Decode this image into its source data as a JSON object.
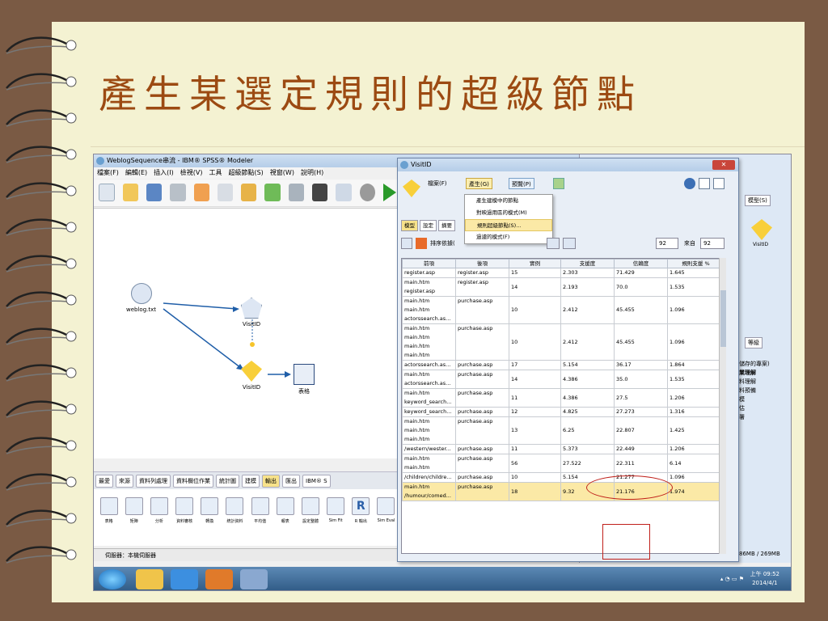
{
  "slide": {
    "title": "產生某選定規則的超級節點"
  },
  "main_window": {
    "title": "WeblogSequence串流 - IBM® SPSS® Modeler",
    "menu": [
      "檔案(F)",
      "編輯(E)",
      "插入(I)",
      "檢視(V)",
      "工具",
      "超級節點(S)",
      "視窗(W)",
      "說明(H)"
    ],
    "nodes": {
      "source": "weblog.txt",
      "seq1": "VisitID",
      "seq2": "VisitID",
      "table": "表格"
    },
    "palette_tabs": [
      "最愛",
      "來源",
      "資料列處理",
      "資料欄位作業",
      "統計圖",
      "建模",
      "輸出",
      "匯出",
      "IBM® S"
    ],
    "palette_items": [
      "表格",
      "矩陣",
      "分析",
      "資料審核",
      "轉換",
      "統計資料",
      "平均值",
      "報表",
      "設定整體",
      "Sim Fit",
      "R 輸出",
      "Sim Eval"
    ],
    "status": "伺服器：本機伺服器",
    "right_panel_button": "模型(S)",
    "right_node": "VisitID",
    "right_tab": "等級",
    "right_list": [
      "儲存的專案)",
      "業理解",
      "料理解",
      "料預備",
      "模",
      "估",
      "署"
    ],
    "memory": "86MB / 269MB"
  },
  "dialog": {
    "title": "VisitID",
    "menu": {
      "file": "檔案(F)",
      "generate": "產生(G)",
      "preview": "預覽(P)"
    },
    "generate_menu": [
      "產生建模中的節點",
      "對映過用區的模式(M)",
      "規則超級節點(S)...",
      "過濾的模式(F)"
    ],
    "tabs": [
      "模型",
      "設定",
      "摘要"
    ],
    "sort_label": "排序依據(",
    "shown_count": "92",
    "of_label": "來自",
    "total_count": "92",
    "columns": [
      "前項",
      "後項",
      "實例",
      "支援度",
      "信賴度",
      "規則支援 %"
    ],
    "rows": [
      {
        "antecedent": [
          "register.asp"
        ],
        "consequent": "register.asp",
        "instances": "15",
        "support": "2.303",
        "confidence": "71.429",
        "rule_support": "1.645"
      },
      {
        "antecedent": [
          "main.htm",
          "register.asp"
        ],
        "consequent": "register.asp",
        "instances": "14",
        "support": "2.193",
        "confidence": "70.0",
        "rule_support": "1.535"
      },
      {
        "antecedent": [
          "main.htm",
          "main.htm",
          "actorssearch.as..."
        ],
        "consequent": "purchase.asp",
        "instances": "10",
        "support": "2.412",
        "confidence": "45.455",
        "rule_support": "1.096"
      },
      {
        "antecedent": [
          "main.htm",
          "main.htm",
          "main.htm",
          "main.htm"
        ],
        "consequent": "purchase.asp",
        "instances": "10",
        "support": "2.412",
        "confidence": "45.455",
        "rule_support": "1.096"
      },
      {
        "antecedent": [
          "actorssearch.as..."
        ],
        "consequent": "purchase.asp",
        "instances": "17",
        "support": "5.154",
        "confidence": "36.17",
        "rule_support": "1.864"
      },
      {
        "antecedent": [
          "main.htm",
          "actorssearch.as..."
        ],
        "consequent": "purchase.asp",
        "instances": "14",
        "support": "4.386",
        "confidence": "35.0",
        "rule_support": "1.535"
      },
      {
        "antecedent": [
          "main.htm",
          "keyword_search..."
        ],
        "consequent": "purchase.asp",
        "instances": "11",
        "support": "4.386",
        "confidence": "27.5",
        "rule_support": "1.206"
      },
      {
        "antecedent": [
          "keyword_search..."
        ],
        "consequent": "purchase.asp",
        "instances": "12",
        "support": "4.825",
        "confidence": "27.273",
        "rule_support": "1.316"
      },
      {
        "antecedent": [
          "main.htm",
          "main.htm",
          "main.htm"
        ],
        "consequent": "purchase.asp",
        "instances": "13",
        "support": "6.25",
        "confidence": "22.807",
        "rule_support": "1.425"
      },
      {
        "antecedent": [
          "/western/wester..."
        ],
        "consequent": "purchase.asp",
        "instances": "11",
        "support": "5.373",
        "confidence": "22.449",
        "rule_support": "1.206"
      },
      {
        "antecedent": [
          "main.htm",
          "main.htm"
        ],
        "consequent": "purchase.asp",
        "instances": "56",
        "support": "27.522",
        "confidence": "22.311",
        "rule_support": "6.14"
      },
      {
        "antecedent": [
          "/children/childre..."
        ],
        "consequent": "purchase.asp",
        "instances": "10",
        "support": "5.154",
        "confidence": "21.277",
        "rule_support": "1.096"
      },
      {
        "antecedent": [
          "main.htm",
          "/humour/comed..."
        ],
        "consequent": "purchase.asp",
        "instances": "18",
        "support": "9.32",
        "confidence": "21.176",
        "rule_support": "1.974",
        "selected": true
      }
    ]
  },
  "taskbar": {
    "time": "上午 09:52",
    "date": "2014/4/1"
  }
}
